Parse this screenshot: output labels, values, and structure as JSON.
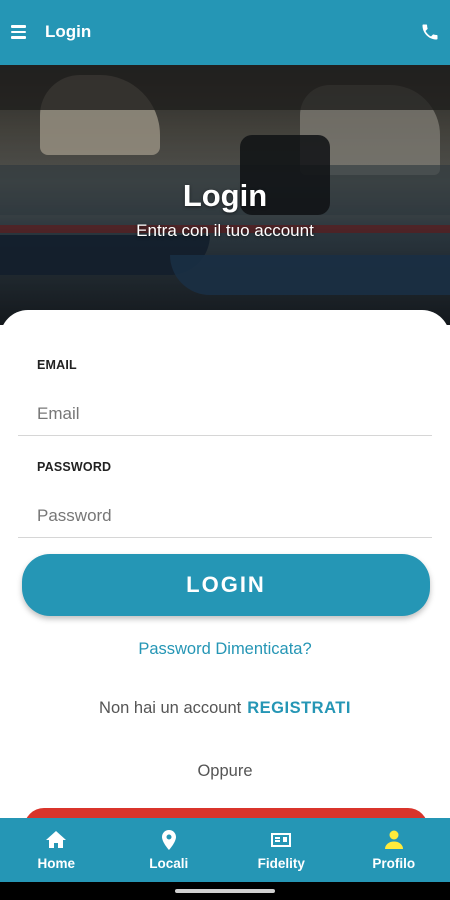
{
  "appbar": {
    "title": "Login",
    "menu_icon": "hamburger-menu-icon",
    "phone_icon": "phone-icon",
    "color": "#2596b5"
  },
  "hero": {
    "title": "Login",
    "subtitle": "Entra con il tuo account"
  },
  "form": {
    "email": {
      "label": "EMAIL",
      "placeholder": "Email",
      "value": ""
    },
    "password": {
      "label": "PASSWORD",
      "placeholder": "Password",
      "value": ""
    },
    "login_button": "LOGIN",
    "forgot_password": "Password Dimenticata?",
    "no_account_text": "Non hai un account",
    "register_link": "REGISTRATI",
    "or_text": "Oppure"
  },
  "bottom_nav": {
    "items": [
      {
        "label": "Home",
        "icon": "home-icon"
      },
      {
        "label": "Locali",
        "icon": "map-pin-icon"
      },
      {
        "label": "Fidelity",
        "icon": "id-card-icon"
      },
      {
        "label": "Profilo",
        "icon": "user-icon",
        "active": true,
        "active_color": "#ffeb3b"
      }
    ]
  },
  "colors": {
    "primary": "#2596b5",
    "social_button": "#d9342b"
  }
}
